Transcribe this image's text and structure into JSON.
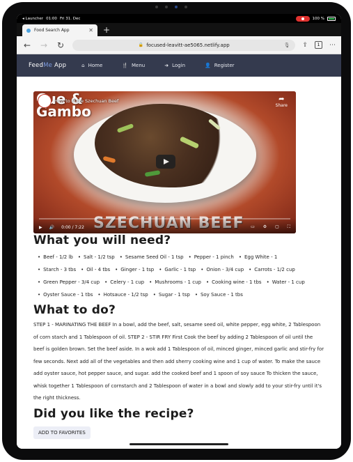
{
  "status_bar": {
    "launcher": "◂ Launcher",
    "time": "01:00",
    "date": "Fri 31. Dec",
    "battery": "100 %"
  },
  "browser": {
    "tab_title": "Food Search App",
    "url": "focused-leavitt-ae5065.netlify.app",
    "tab_count": "1"
  },
  "app_nav": {
    "brand_prefix": "Feed",
    "brand_me": "Me",
    "brand_suffix": " App",
    "links": [
      {
        "label": "Home",
        "icon": "home-icon"
      },
      {
        "label": "Menu",
        "icon": "utensils-icon"
      },
      {
        "label": "Login",
        "icon": "login-icon"
      },
      {
        "label": "Register",
        "icon": "user-plus-icon"
      }
    ]
  },
  "video": {
    "overlay_brand_line1": "Cue &",
    "overlay_brand_line2": "Gambo",
    "title": "How to Make Szechuan Beef",
    "share_label": "Share",
    "dish_title": "SZECHUAN BEEF",
    "time": "0:00 / 7:22"
  },
  "sections": {
    "need_heading": "What you will need?",
    "todo_heading": "What to do?",
    "like_heading": "Did you like the recipe?"
  },
  "ingredients": [
    "Beef - 1/2 lb",
    "Salt - 1/2 tsp",
    "Sesame Seed Oil - 1 tsp",
    "Pepper - 1 pinch",
    "Egg White - 1",
    "Starch - 3 tbs",
    "Oil - 4 tbs",
    "Ginger - 1 tsp",
    "Garlic - 1 tsp",
    "Onion - 3/4 cup",
    "Carrots - 1/2 cup",
    "Green Pepper - 3/4 cup",
    "Celery - 1 cup",
    "Mushrooms - 1 cup",
    "Cooking wine - 1 tbs",
    "Water - 1 cup",
    "Oyster Sauce - 1 tbs",
    "Hotsauce - 1/2 tsp",
    "Sugar - 1 tsp",
    "Soy Sauce - 1 tbs"
  ],
  "instructions": "STEP 1 - MARINATING THE BEEF In a bowl, add the beef, salt, sesame seed oil, white pepper, egg white, 2 Tablespoon of corn starch and 1 Tablespoon of oil. STEP 2 - STIR FRY First Cook the beef by adding 2 Tablespoon of oil until the beef is golden brown. Set the beef aside. In a wok add 1 Tablespoon of oil, minced ginger, minced garlic and stir-fry for few seconds. Next add all of the vegetables and then add sherry cooking wine and 1 cup of water. To make the sauce add oyster sauce, hot pepper sauce, and sugar. add the cooked beef and 1 spoon of soy sauce To thicken the sauce, whisk together 1 Tablespoon of cornstarch and 2 Tablespoon of water in a bowl and slowly add to your stir-fry until it's the right thickness.",
  "favorites_button": "ADD TO FAVORITES"
}
